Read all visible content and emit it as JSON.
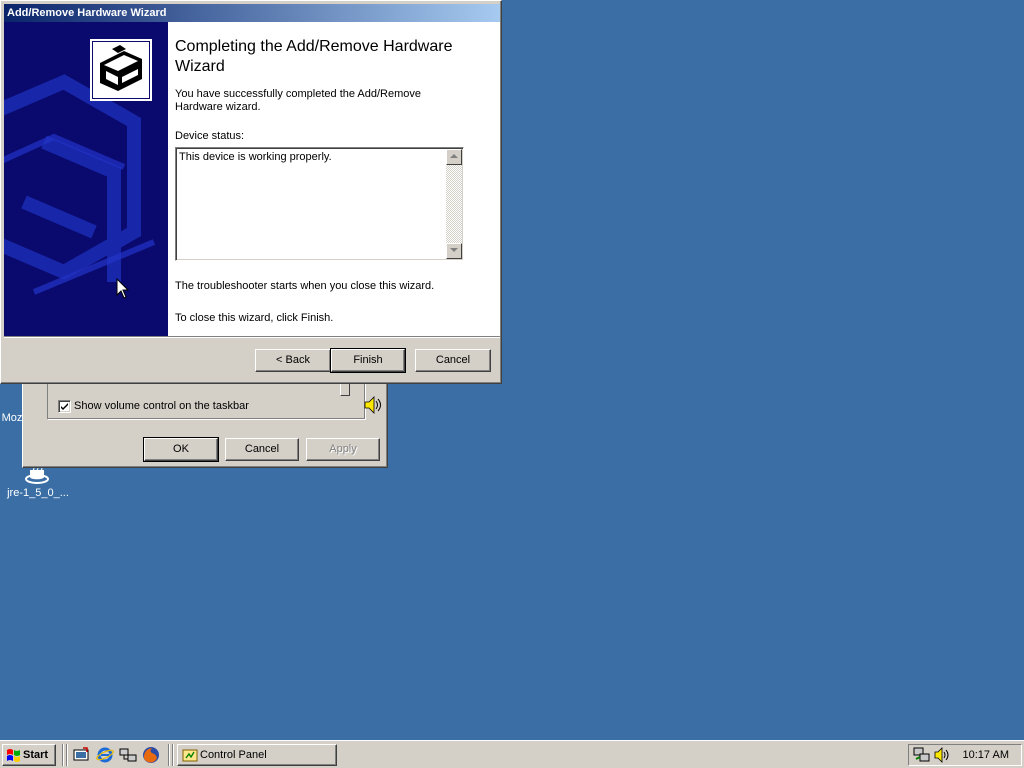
{
  "wizard": {
    "title": "Add/Remove Hardware Wizard",
    "heading": "Completing the Add/Remove Hardware Wizard",
    "description": "You have successfully completed the Add/Remove Hardware wizard.",
    "status_label": "Device status:",
    "status_text": "This device is working properly.",
    "troubleshooter_note": "The troubleshooter starts when you close this wizard.",
    "close_instruction": "To close this wizard, click Finish.",
    "buttons": {
      "back": "< Back",
      "finish": "Finish",
      "cancel": "Cancel"
    }
  },
  "sound_dialog": {
    "checkbox_label": "Show volume control on the taskbar",
    "checkbox_checked": true,
    "buttons": {
      "ok": "OK",
      "cancel": "Cancel",
      "apply": "Apply"
    }
  },
  "desktop": {
    "icons": [
      {
        "label": "Moz"
      },
      {
        "label": "jre-1_5_0_..."
      }
    ]
  },
  "taskbar": {
    "start_label": "Start",
    "quick_launch": [
      "show-desktop-icon",
      "internet-explorer-icon",
      "network-icon",
      "firefox-icon"
    ],
    "tasks": [
      {
        "label": "Control Panel"
      }
    ],
    "clock": "10:17 AM"
  },
  "colors": {
    "desktop": "#3a6ea5",
    "titlebar_start": "#0a246a",
    "titlebar_end": "#a6caf0",
    "window_face": "#d4d0c8",
    "wizard_side": "#0a0a6e"
  }
}
